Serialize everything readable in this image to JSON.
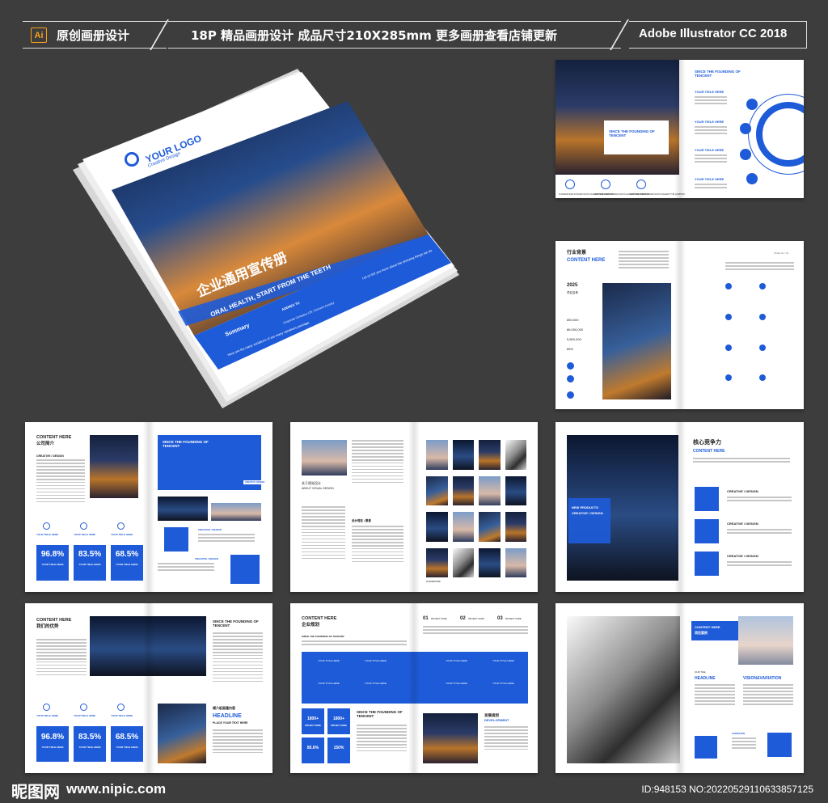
{
  "header": {
    "left_label": "原创画册设计",
    "center_label": "18P 精品画册设计 成品尺寸210X285mm 更多画册查看店铺更新",
    "right_label": "Adobe Illustrator CC 2018",
    "ai_icon_text": "Ai"
  },
  "cover": {
    "logo_text": "YOUR LOGO",
    "logo_sub": "Creative Design",
    "title_cn": "企业通用宣传册",
    "title_en": "ORAL HEALTH, START FROM THE TEETH",
    "blurb": "Let us tell you more about the amazing things we do.",
    "summary": "Summary",
    "summary_text": "Here are the many variations of  are many variations passage.",
    "addres_label": "ADDRES TO",
    "addres_text": "Corporate Company 125, Carcount Country"
  },
  "spread1": {
    "since_title": "SINCE THE FOUNDING OF TENCENT",
    "right_title": "SINCE THE FOUNDING OF TENCENT",
    "items": [
      "YOUR TIELE HERE",
      "YOUR TIELE HERE",
      "YOUR TIELE HERE",
      "YOUR TIELE HERE"
    ],
    "captions": [
      "SUSPENDISSE SUSCIER NON PLACERAT THE COMPANY",
      "SUSPENDISSE SUSCIER NON PLACERAT THE COMPANY",
      "SUSPENDISSE SUSCIER NON PLACERAT THE COMPANY"
    ]
  },
  "spread2": {
    "title_cn": "行业背景",
    "title_en": "CONTENT HERE",
    "year": "2025",
    "year_label": "项目名称",
    "stats": [
      "850,000",
      "86,000,000",
      "5,800,000",
      "85%"
    ],
    "page_label": "PAGE 01 / 03"
  },
  "spread3": {
    "title": "CONTENT HERE",
    "title_cn": "公司简介",
    "creative": "CREATIVE / DESIGN",
    "since_title": "SINCE THE FOUNDING OF TENCENT",
    "badge": "CREATIVE / DESIGN",
    "item_label": "YOUR TIELE HERE",
    "percents": [
      "96.8%",
      "83.5%",
      "68.5%"
    ],
    "percent_label": "YOUR TIELE HERE",
    "creative2": "CREATIVE / DESIGN",
    "creative3": "CREATIVE / DESIGN"
  },
  "spread4": {
    "title_cn": "关于视觉设计",
    "title_en": "ABOUT VISUAL DESIGN",
    "mid_cn": "设计理念 / 愿景",
    "caption": "SUSPENDISSE"
  },
  "spread5": {
    "title_cn": "核心竞争力",
    "title_en": "CONTENT HERE",
    "box_title": "NEW PRODUCTS",
    "box_sub": "CREATIVE / DESIGN",
    "items": [
      "CREATIVE / DESIGN",
      "CREATIVE / DESIGN",
      "CREATIVE / DESIGN"
    ]
  },
  "spread6": {
    "title": "CONTENT HERE",
    "title_cn": "我们的优势",
    "since_title": "SINCE THE FOUNDING OF TENCENT",
    "item_label": "YOUR TIELE HERE",
    "percents": [
      "96.8%",
      "83.5%",
      "68.5%"
    ],
    "percent_label": "YOUR TIELE HERE",
    "place_cn": "横六板面建内容",
    "headline": "HEADLINE",
    "place_text": "PLACE YOUR TEXT HERE"
  },
  "spread7": {
    "title": "CONTENT HERE",
    "title_cn": "企业规划",
    "sub": "SINCE THE FOUNDING OF TENCENT",
    "steps": [
      "01",
      "02",
      "03"
    ],
    "step_label": "PROJECT NAME",
    "tile_label": "YOUR TITLE HERE",
    "nums": [
      "1800+",
      "1800+",
      "85.6%",
      "150%"
    ],
    "num_label": "PROJECT NAME",
    "since_title": "SINCE THE FOUNDING OF TENCENT",
    "dev_cn": "发展规划",
    "dev_en": "DEVELOPMENT"
  },
  "spread8": {
    "box_title": "CONTENT HERE",
    "box_cn": "项目案例",
    "our": "OUR THE",
    "headline": "HEADLINE",
    "vision": "VISION&VARIATION",
    "variation": "VARIATION"
  },
  "footer": {
    "logo": "昵图网",
    "url": "www.nipic.com",
    "id_text": "ID:948153 NO:20220529110633857125"
  },
  "colors": {
    "accent": "#1e5bd8",
    "background": "#3d3d3d",
    "ai_orange": "#f7a11a"
  }
}
